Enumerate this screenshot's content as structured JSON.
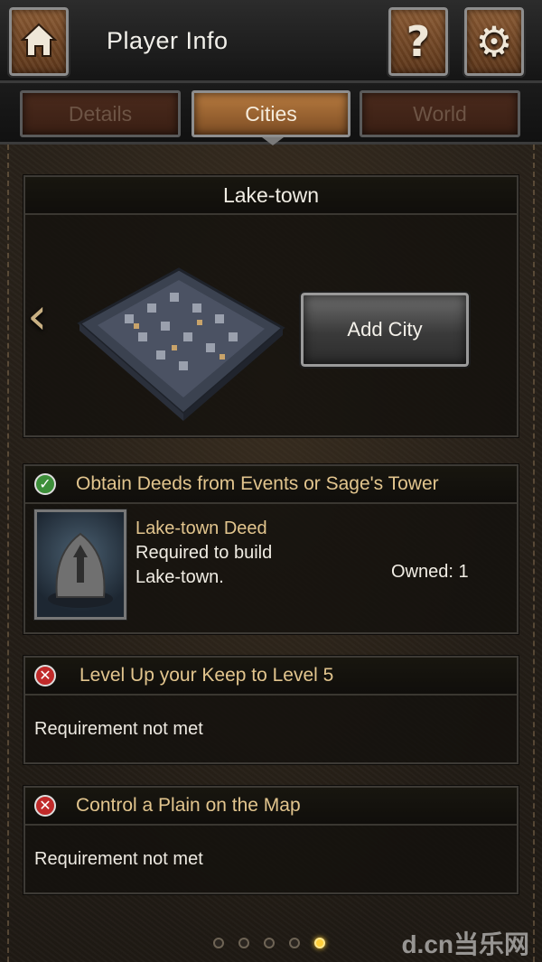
{
  "header": {
    "title": "Player Info",
    "home_icon": "home-icon",
    "help_icon": "help-icon",
    "settings_icon": "gear-icon"
  },
  "tabs": [
    {
      "label": "Details",
      "active": false
    },
    {
      "label": "Cities",
      "active": true
    },
    {
      "label": "World",
      "active": false
    }
  ],
  "city": {
    "name": "Lake-town",
    "add_city_label": "Add City",
    "prev_icon": "chevron-left-icon"
  },
  "requirements": [
    {
      "status": "met",
      "title": "Obtain Deeds from Events or Sage's Tower",
      "item_name": "Lake-town Deed",
      "item_desc_line1": "Required to build",
      "item_desc_line2": "Lake-town.",
      "owned": "Owned: 1"
    },
    {
      "status": "not_met",
      "title": "Level Up your Keep to Level 5",
      "body": "Requirement not met"
    },
    {
      "status": "not_met",
      "title": "Control a Plain on the Map",
      "body": "Requirement not met"
    }
  ],
  "pagination": {
    "count": 5,
    "active_index": 4
  },
  "watermark": "d.cn当乐网",
  "colors": {
    "accent": "#b77a3f",
    "requirement_title": "#e2c58e",
    "ok": "#3d8f3a",
    "fail": "#c02a2a",
    "active_dot": "#ffcf3a"
  }
}
